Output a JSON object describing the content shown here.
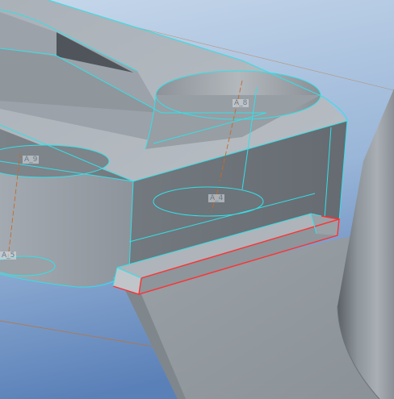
{
  "viewport": {
    "background_top": "#c4d5e8",
    "background_bottom": "#5f86bd",
    "edge_highlight_color": "#33e0e8",
    "selection_color": "#ff3030",
    "datum_axis_color": "#c86a28"
  },
  "axis_labels": [
    "A_8",
    "A_9",
    "A_4",
    "A_5"
  ],
  "icons": [
    "datum-axis-icon"
  ]
}
